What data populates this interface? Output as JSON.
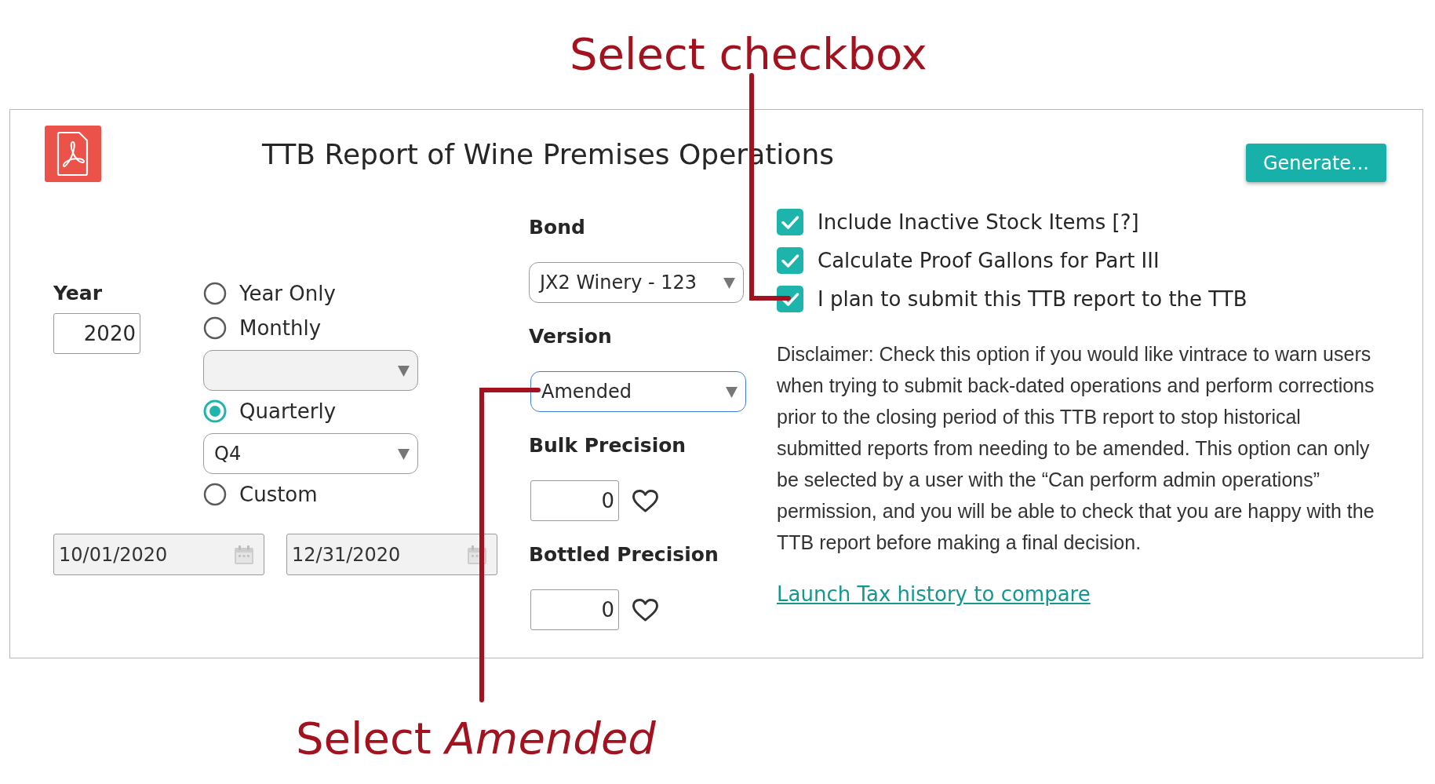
{
  "callouts": [
    {
      "kind": "top",
      "text": "Select checkbox"
    },
    {
      "kind": "bottom",
      "text": "Select *Amended*"
    }
  ],
  "report": {
    "title": "TTB Report of Wine Premises Operations",
    "generate_button": "Generate..."
  },
  "year": {
    "label": "Year",
    "value": "2020"
  },
  "period_options": [
    {
      "label": "Year Only",
      "selected": false
    },
    {
      "label": "Monthly",
      "selected": false,
      "dropdown": {
        "disabled": true
      }
    },
    {
      "label": "Quarterly",
      "selected": true,
      "dropdown": {
        "value": "Q4",
        "disabled": false
      }
    },
    {
      "label": "Custom",
      "selected": false
    }
  ],
  "date_range": {
    "start": "10/01/2020",
    "end": "12/31/2020",
    "disabled": true
  },
  "bond": {
    "label": "Bond",
    "value": "JX2 Winery - 123",
    "focused": false
  },
  "version": {
    "label": "Version",
    "value": "Amended",
    "focused": true
  },
  "precision_fields": [
    {
      "label": "Bulk Precision",
      "value": "0"
    },
    {
      "label": "Bottled Precision",
      "value": "0"
    }
  ],
  "report_options": [
    {
      "label": "Include Inactive Stock Items [?]",
      "checked": true
    },
    {
      "label": "Calculate Proof Gallons for Part III",
      "checked": true
    },
    {
      "label": "I plan to submit this TTB report to the TTB",
      "checked": true
    }
  ],
  "disclaimer": "Disclaimer: Check this option if you would like vintrace to warn users\nwhen trying to submit back-dated operations and perform corrections\nprior to the closing period of this TTB report to stop historical\nsubmitted reports from needing to be amended. This option can only\nbe selected by a user with the “Can perform admin operations”\npermission, and you will be able to check that you are happy with the\nTTB report before making a final decision.",
  "compare_link": "Launch Tax history to compare"
}
